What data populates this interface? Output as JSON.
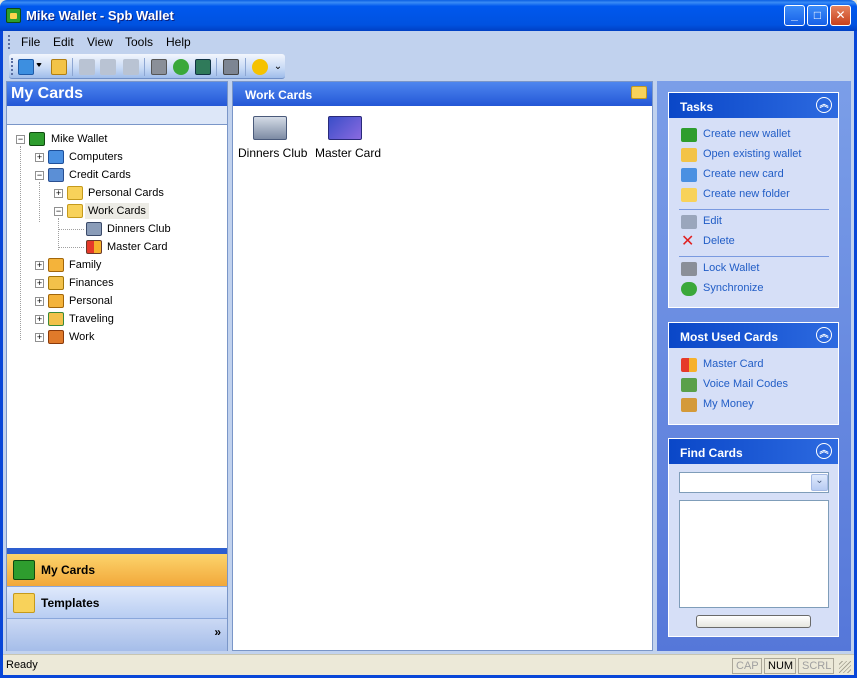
{
  "window": {
    "title": "Mike Wallet - Spb Wallet",
    "minimize": "_",
    "maximize": "□",
    "close": "✕"
  },
  "menu": [
    {
      "label": "File"
    },
    {
      "label": "Edit"
    },
    {
      "label": "View"
    },
    {
      "label": "Tools"
    },
    {
      "label": "Help"
    }
  ],
  "toolbar": {
    "icons": [
      "new-card-icon",
      "open-folder-icon",
      "cut-icon",
      "copy-icon",
      "paste-icon",
      "lock-icon",
      "synchronize-icon",
      "save-icon",
      "properties-icon",
      "help-icon"
    ],
    "overflow": "⌄"
  },
  "left_panel": {
    "title": "My Cards",
    "tree": {
      "root": "Mike Wallet",
      "computers": "Computers",
      "credit_cards": "Credit Cards",
      "personal_cards": "Personal Cards",
      "work_cards": "Work Cards",
      "dinners_club": "Dinners Club",
      "master_card": "Master Card",
      "family": "Family",
      "finances": "Finances",
      "personal": "Personal",
      "traveling": "Traveling",
      "work": "Work"
    },
    "nav": {
      "my_cards": "My Cards",
      "templates": "Templates",
      "more": "»"
    }
  },
  "center_panel": {
    "title": "Work Cards",
    "cards": [
      {
        "label": "Dinners Club"
      },
      {
        "label": "Master Card"
      }
    ]
  },
  "tasks": {
    "title": "Tasks",
    "toggle": "︽",
    "create_new_wallet": "Create new wallet",
    "open_existing_wallet": "Open existing wallet",
    "create_new_card": "Create new card",
    "create_new_folder": "Create new folder",
    "edit": "Edit",
    "delete": "Delete",
    "lock_wallet": "Lock Wallet",
    "synchronize": "Synchronize"
  },
  "most_used": {
    "title": "Most Used Cards",
    "toggle": "︽",
    "items": [
      "Master Card",
      "Voice Mail Codes",
      "My Money"
    ]
  },
  "find_cards": {
    "title": "Find Cards",
    "toggle": "︽",
    "dropdown_value": "",
    "dropdown_arrow": "⌄"
  },
  "status": {
    "text": "Ready",
    "cap": "CAP",
    "num": "NUM",
    "scrl": "SCRL"
  },
  "colors": {
    "title_blue": "#0058ee",
    "link_blue": "#215dc6",
    "nav_orange": "#f2a83a"
  }
}
